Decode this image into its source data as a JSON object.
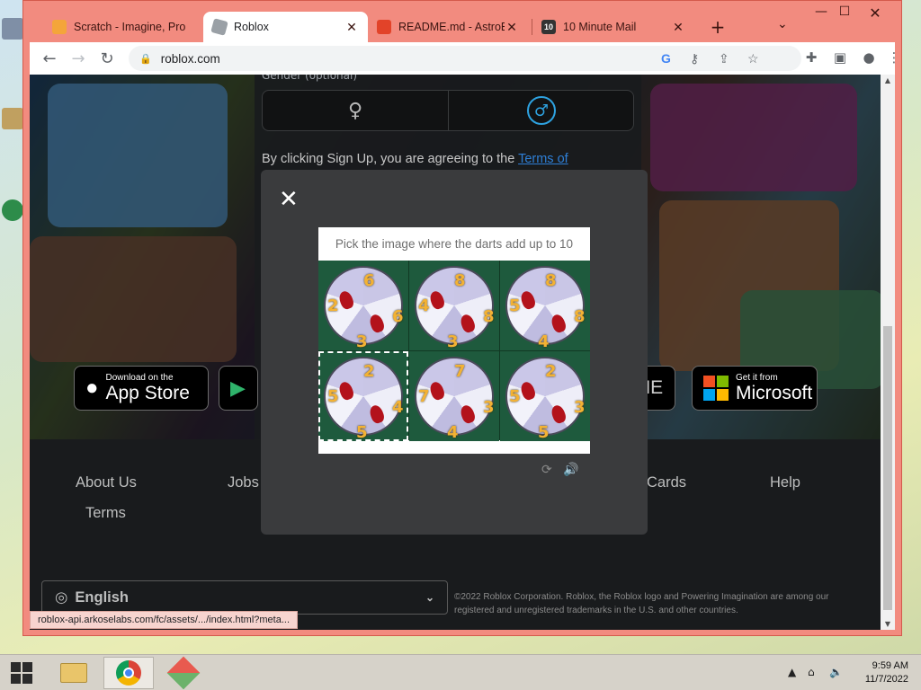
{
  "browser": {
    "tabs": [
      {
        "title": "Scratch - Imagine, Pro",
        "icon": "scratch-icon"
      },
      {
        "title": "Roblox",
        "icon": "roblox-icon"
      },
      {
        "title": "README.md - AstroBl",
        "icon": "gitlab-icon"
      },
      {
        "title": "10 Minute Mail",
        "icon": "ten-minute-mail-icon",
        "badge": "10"
      }
    ],
    "new_tab": "+",
    "url": "roblox.com",
    "status_url": "roblox-api.arkoselabs.com/fc/assets/.../index.html?meta..."
  },
  "page": {
    "gender_label": "Gender (optional)",
    "agree_text": "By clicking Sign Up, you are agreeing to the ",
    "agree_link": "Terms of",
    "badges": [
      {
        "small": "Download on the",
        "big": "App Store",
        "icon": "apple-icon"
      },
      {
        "small": "",
        "big": "",
        "icon": "google-play-icon"
      },
      {
        "small": "",
        "big": "NE",
        "icon": ""
      },
      {
        "small": "Get it from",
        "big": "Microsoft",
        "icon": "microsoft-icon"
      }
    ],
    "footer_links": [
      "About Us",
      "Jobs",
      "Cards",
      "Help",
      "Terms"
    ],
    "language": "English",
    "copyright": "©2022 Roblox Corporation. Roblox, the Roblox logo and Powering Imagination are among our registered and unregistered trademarks in the U.S. and other countries."
  },
  "captcha": {
    "instruction": "Pick the image where the darts add up to 10",
    "cells": [
      {
        "numbers": [
          "6",
          "2",
          "6",
          "3"
        ],
        "selected": false
      },
      {
        "numbers": [
          "8",
          "4",
          "8",
          "3"
        ],
        "selected": false
      },
      {
        "numbers": [
          "8",
          "5",
          "8",
          "4"
        ],
        "selected": false
      },
      {
        "numbers": [
          "2",
          "5",
          "4",
          "5"
        ],
        "selected": true
      },
      {
        "numbers": [
          "7",
          "7",
          "3",
          "4"
        ],
        "selected": false
      },
      {
        "numbers": [
          "2",
          "5",
          "3",
          "5"
        ],
        "selected": false
      }
    ],
    "close_label": "✕"
  },
  "taskbar": {
    "time": "9:59 AM",
    "date": "11/7/2022"
  },
  "colors": {
    "browser_frame": "#f28b7f",
    "page_bg": "#191b1d",
    "link": "#2e7fd6",
    "dart_number": "#f3b234",
    "dart": "#b3121b"
  }
}
